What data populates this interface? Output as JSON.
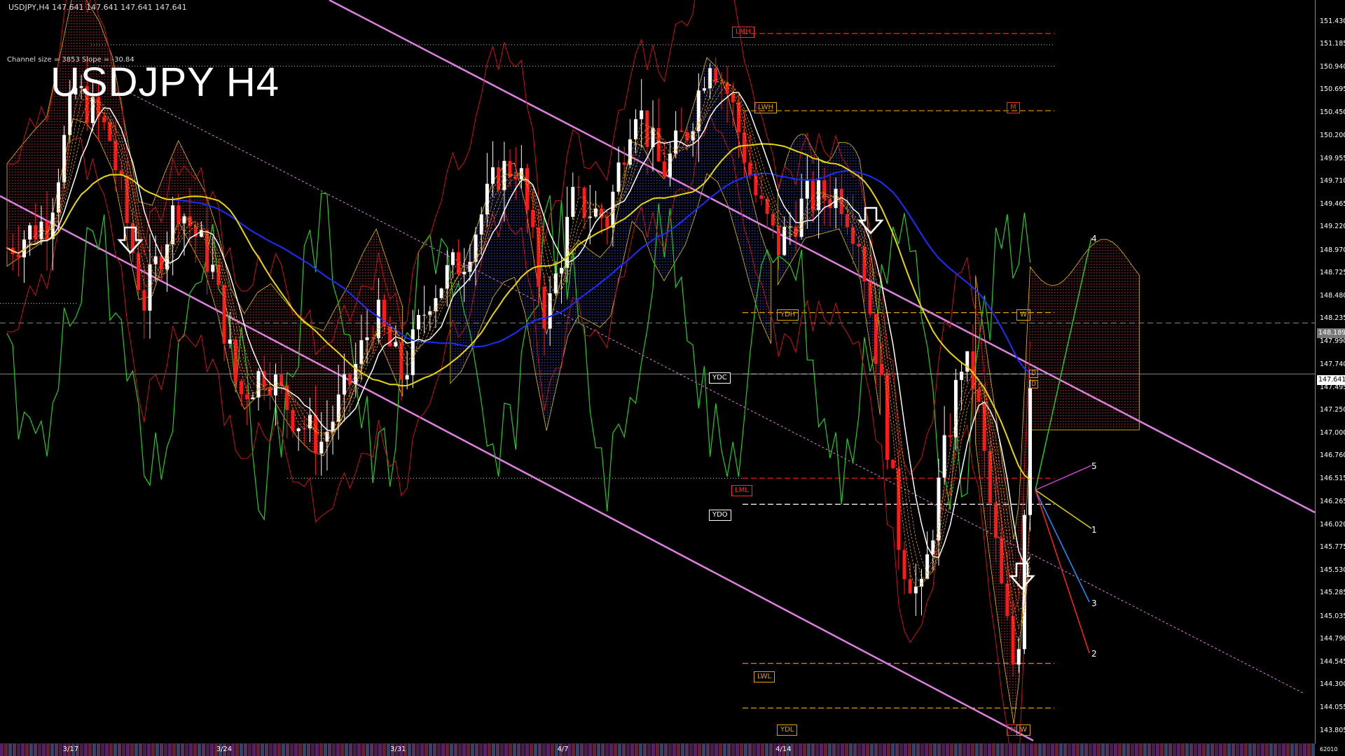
{
  "header": {
    "info": "USDJPY,H4  147.641 147.641 147.641 147.641",
    "channel": "Channel size = 3853 Slope = -30.84",
    "title": "USDJPY H4"
  },
  "colors": {
    "background": "#000000",
    "up_candle": "#ffffff",
    "down_candle": "#ff1a1a",
    "ma_blue": "#1a2fff",
    "ma_yellow": "#e8d800",
    "ma_white": "#ffffff",
    "oscillator_green": "#22cc22",
    "envelope_red": "#cc1111",
    "channel_magenta": "#e080e0",
    "kumo_red": "#aa1010",
    "kumo_blue": "#1530c0"
  },
  "level_tags": [
    {
      "id": "lmh",
      "label": "LMH",
      "style": "red"
    },
    {
      "id": "lwh",
      "label": "LWH",
      "style": "org"
    },
    {
      "id": "m_top",
      "label": "M",
      "style": "red"
    },
    {
      "id": "ydh",
      "label": "YDH",
      "style": "org"
    },
    {
      "id": "w_top",
      "label": "W",
      "style": "org"
    },
    {
      "id": "ydc",
      "label": "YDC",
      "style": "wht"
    },
    {
      "id": "lml",
      "label": "LML",
      "style": "red"
    },
    {
      "id": "ydo",
      "label": "YDO",
      "style": "wht"
    },
    {
      "id": "lwl",
      "label": "LWL",
      "style": "org"
    },
    {
      "id": "ydl",
      "label": "YDL",
      "style": "org"
    },
    {
      "id": "m_bot",
      "label": "M",
      "style": "red"
    },
    {
      "id": "w_bot",
      "label": "W",
      "style": "org"
    },
    {
      "id": "d1",
      "label": "D",
      "style": "org"
    },
    {
      "id": "d2",
      "label": "D",
      "style": "org"
    }
  ],
  "price_labels": {
    "dashed": "148.189",
    "current": "147.641",
    "corner": "62010"
  },
  "projection_labels": [
    "4",
    "5",
    "1",
    "3",
    "2"
  ],
  "chart_data": {
    "type": "line",
    "title": "USDJPY H4",
    "xlabel": "",
    "ylabel": "",
    "y_ticks": [
      "151.430",
      "151.185",
      "150.940",
      "150.695",
      "150.450",
      "150.200",
      "149.955",
      "149.710",
      "149.465",
      "149.220",
      "148.970",
      "148.725",
      "148.480",
      "148.235",
      "147.990",
      "147.740",
      "147.495",
      "147.250",
      "147.000",
      "146.760",
      "146.515",
      "146.265",
      "146.020",
      "145.775",
      "145.530",
      "145.285",
      "145.035",
      "144.790",
      "144.545",
      "144.300",
      "144.055",
      "143.805"
    ],
    "x_ticks": [
      "3/17",
      "3/24",
      "3/31",
      "4/7",
      "4/14"
    ],
    "ylim": [
      143.7,
      151.6
    ],
    "grid": false,
    "horizontal_levels": [
      {
        "name": "LMH",
        "price": 151.3
      },
      {
        "name": "LWH",
        "price": 150.47
      },
      {
        "name": "YDH",
        "price": 148.3
      },
      {
        "name": "YDC",
        "price": 147.64
      },
      {
        "name": "LML",
        "price": 146.52
      },
      {
        "name": "YDO",
        "price": 146.24
      },
      {
        "name": "LWL",
        "price": 144.53
      },
      {
        "name": "YDL",
        "price": 144.05
      }
    ],
    "current_price": 147.641,
    "dashed_price": 148.189,
    "close_path": [
      {
        "x": 0.0,
        "y": 149.0
      },
      {
        "x": 0.6,
        "y": 149.3
      },
      {
        "x": 1.0,
        "y": 150.7
      },
      {
        "x": 1.5,
        "y": 150.2
      },
      {
        "x": 2.0,
        "y": 148.4
      },
      {
        "x": 2.5,
        "y": 149.5
      },
      {
        "x": 3.0,
        "y": 148.8
      },
      {
        "x": 3.4,
        "y": 147.4
      },
      {
        "x": 3.8,
        "y": 147.7
      },
      {
        "x": 4.2,
        "y": 147.2
      },
      {
        "x": 4.6,
        "y": 146.9
      },
      {
        "x": 5.0,
        "y": 147.5
      },
      {
        "x": 5.4,
        "y": 148.3
      },
      {
        "x": 5.8,
        "y": 147.6
      },
      {
        "x": 6.2,
        "y": 148.5
      },
      {
        "x": 6.7,
        "y": 148.9
      },
      {
        "x": 7.2,
        "y": 149.8
      },
      {
        "x": 7.5,
        "y": 149.9
      },
      {
        "x": 7.9,
        "y": 148.2
      },
      {
        "x": 8.3,
        "y": 149.5
      },
      {
        "x": 8.8,
        "y": 149.3
      },
      {
        "x": 9.2,
        "y": 150.6
      },
      {
        "x": 9.6,
        "y": 149.8
      },
      {
        "x": 10.0,
        "y": 150.3
      },
      {
        "x": 10.3,
        "y": 151.1
      },
      {
        "x": 10.6,
        "y": 150.6
      },
      {
        "x": 11.0,
        "y": 149.5
      },
      {
        "x": 11.3,
        "y": 149.0
      },
      {
        "x": 11.7,
        "y": 149.5
      },
      {
        "x": 12.2,
        "y": 149.6
      },
      {
        "x": 12.5,
        "y": 149.1
      },
      {
        "x": 12.8,
        "y": 147.6
      },
      {
        "x": 13.1,
        "y": 145.7
      },
      {
        "x": 13.4,
        "y": 145.2
      },
      {
        "x": 13.7,
        "y": 146.6
      },
      {
        "x": 14.0,
        "y": 147.8
      },
      {
        "x": 14.2,
        "y": 147.5
      },
      {
        "x": 14.4,
        "y": 146.3
      },
      {
        "x": 14.6,
        "y": 145.2
      },
      {
        "x": 14.8,
        "y": 144.3
      },
      {
        "x": 15.0,
        "y": 147.64
      }
    ],
    "x_range": [
      0,
      19
    ],
    "series": [
      {
        "name": "",
        "values": []
      }
    ]
  }
}
